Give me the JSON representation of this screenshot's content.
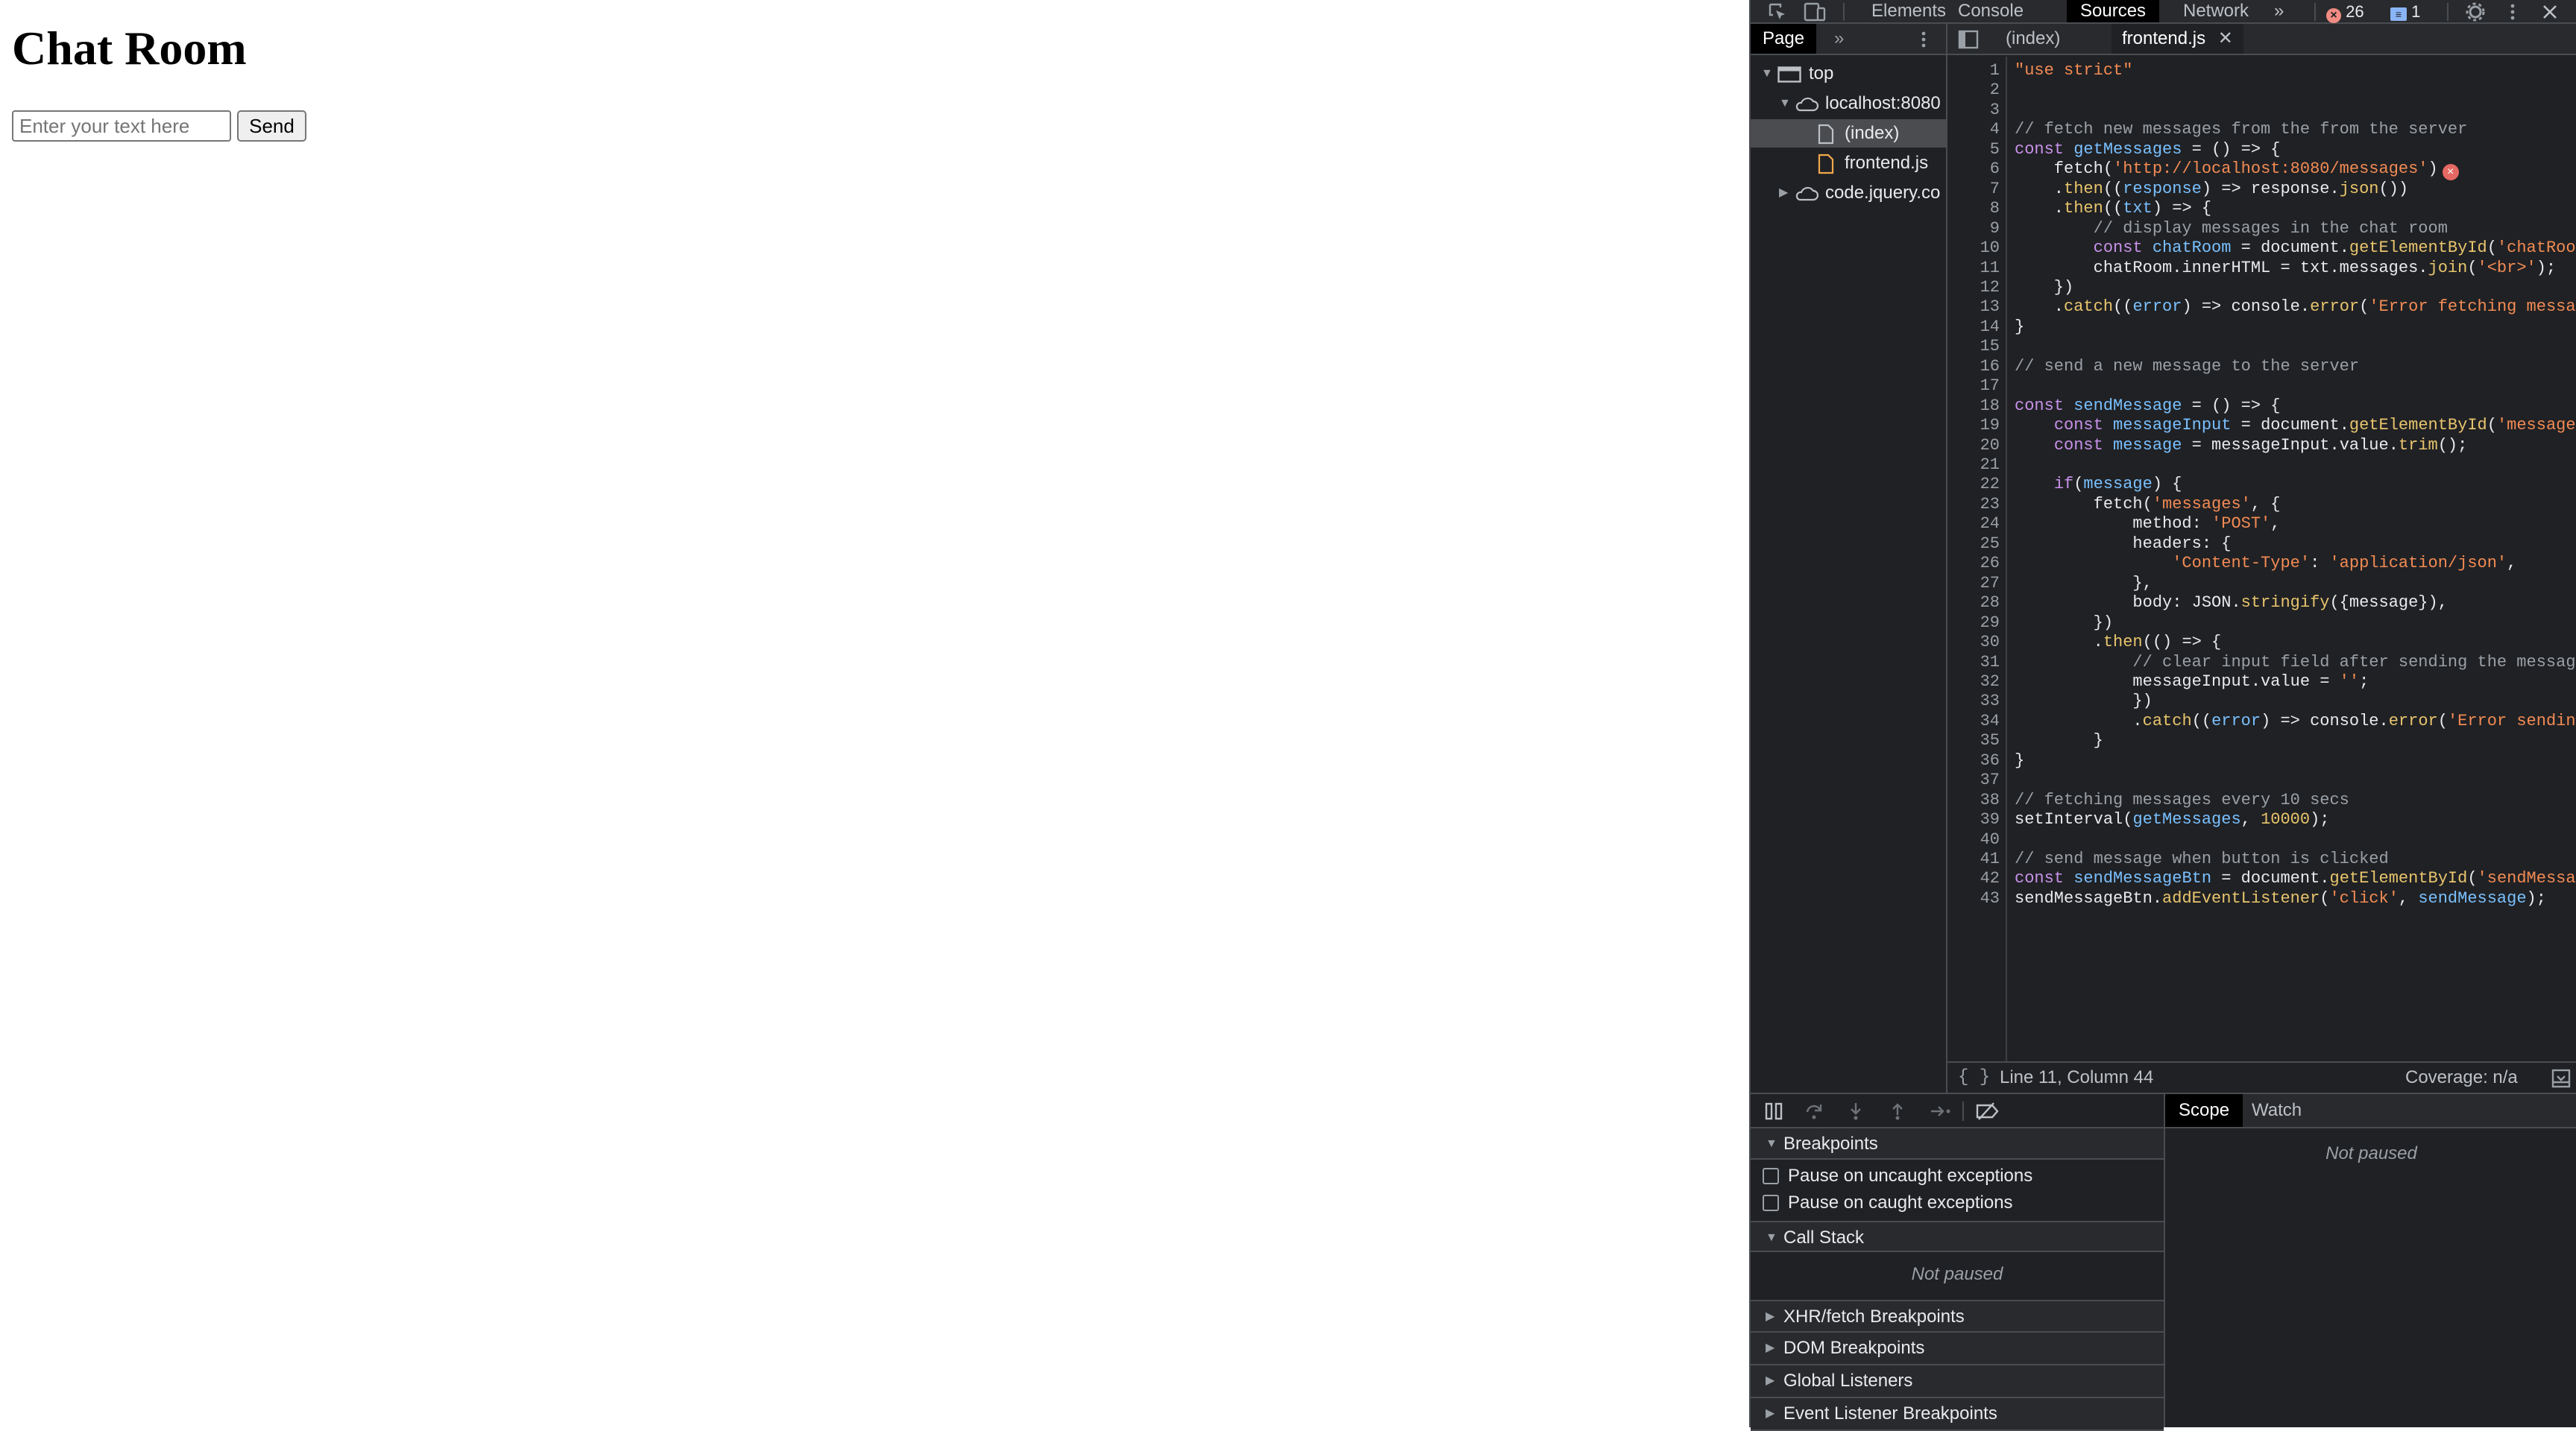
{
  "page": {
    "title": "Chat Room",
    "input_placeholder": "Enter your text here",
    "input_value": "",
    "send_label": "Send"
  },
  "devtools": {
    "tabs": [
      "Elements",
      "Console",
      "Sources",
      "Network"
    ],
    "active_tab": "Sources",
    "more_tabs": "»",
    "error_count": "26",
    "message_count": "1",
    "navigator": {
      "tab": "Page",
      "more": "»",
      "tree": [
        "top",
        "localhost:8080",
        "(index)",
        "frontend.js",
        "code.jquery.co"
      ]
    },
    "editor": {
      "tabs": [
        "(index)",
        "frontend.js"
      ],
      "active_tab": "frontend.js",
      "status": "Line 11, Column 44",
      "coverage": "Coverage: n/a",
      "lines": [
        "\"use strict\"",
        "",
        "",
        "// fetch new messages from the from the server",
        "const getMessages = () => {",
        "    fetch('http://localhost:8080/messages')",
        "    .then((response) => response.json())",
        "    .then((txt) => {",
        "        // display messages in the chat room",
        "        const chatRoom = document.getElementById('chatRoo",
        "        chatRoom.innerHTML = txt.messages.join('<br>');",
        "    })",
        "    .catch((error) => console.error('Error fetching messa",
        "}",
        "",
        "// send a new message to the server",
        "",
        "const sendMessage = () => {",
        "    const messageInput = document.getElementById('message",
        "    const message = messageInput.value.trim();",
        "",
        "    if(message) {",
        "        fetch('messages', {",
        "            method: 'POST',",
        "            headers: {",
        "                'Content-Type': 'application/json',",
        "            },",
        "            body: JSON.stringify({message}),",
        "        })",
        "        .then(() => {",
        "            // clear input field after sending the messag",
        "            messageInput.value = '';",
        "            })",
        "            .catch((error) => console.error('Error sendin",
        "        }",
        "}",
        "",
        "// fetching messages every 10 secs",
        "setInterval(getMessages, 10000);",
        "",
        "// send message when button is clicked",
        "const sendMessageBtn = document.getElementById('sendMessa",
        "sendMessageBtn.addEventListener('click', sendMessage);"
      ]
    },
    "debugger": {
      "breakpoints_label": "Breakpoints",
      "pause_uncaught": "Pause on uncaught exceptions",
      "pause_caught": "Pause on caught exceptions",
      "call_stack_label": "Call Stack",
      "not_paused": "Not paused",
      "sections": [
        "XHR/fetch Breakpoints",
        "DOM Breakpoints",
        "Global Listeners",
        "Event Listener Breakpoints"
      ],
      "scope_tab": "Scope",
      "watch_tab": "Watch",
      "scope_not_paused": "Not paused"
    },
    "colors": {
      "background": "#202124",
      "keyword": "#c792ea",
      "string": "#f28b54",
      "comment": "#9aa0a6",
      "property": "#79c0ff",
      "number": "#e8c56d",
      "error": "#f28b82",
      "info": "#8ab4f8"
    }
  }
}
